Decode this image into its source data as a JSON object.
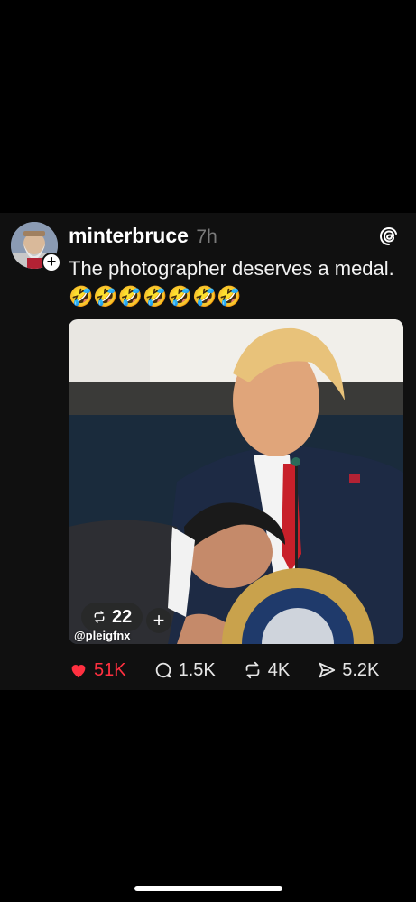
{
  "post": {
    "username": "minterbruce",
    "time": "7h",
    "text": "The photographer deserves a medal.🤣🤣🤣🤣🤣🤣🤣",
    "media": {
      "watermark": "@pleigfnx",
      "repost_count": "22"
    },
    "actions": {
      "likes": "51K",
      "replies": "1.5K",
      "reposts": "4K",
      "shares": "5.2K"
    }
  },
  "colors": {
    "like": "#ff3040",
    "background": "#000000",
    "card": "#101010"
  },
  "icons": [
    "follow-plus-icon",
    "threads-logo-icon",
    "heart-icon",
    "reply-icon",
    "repost-icon",
    "share-icon"
  ]
}
